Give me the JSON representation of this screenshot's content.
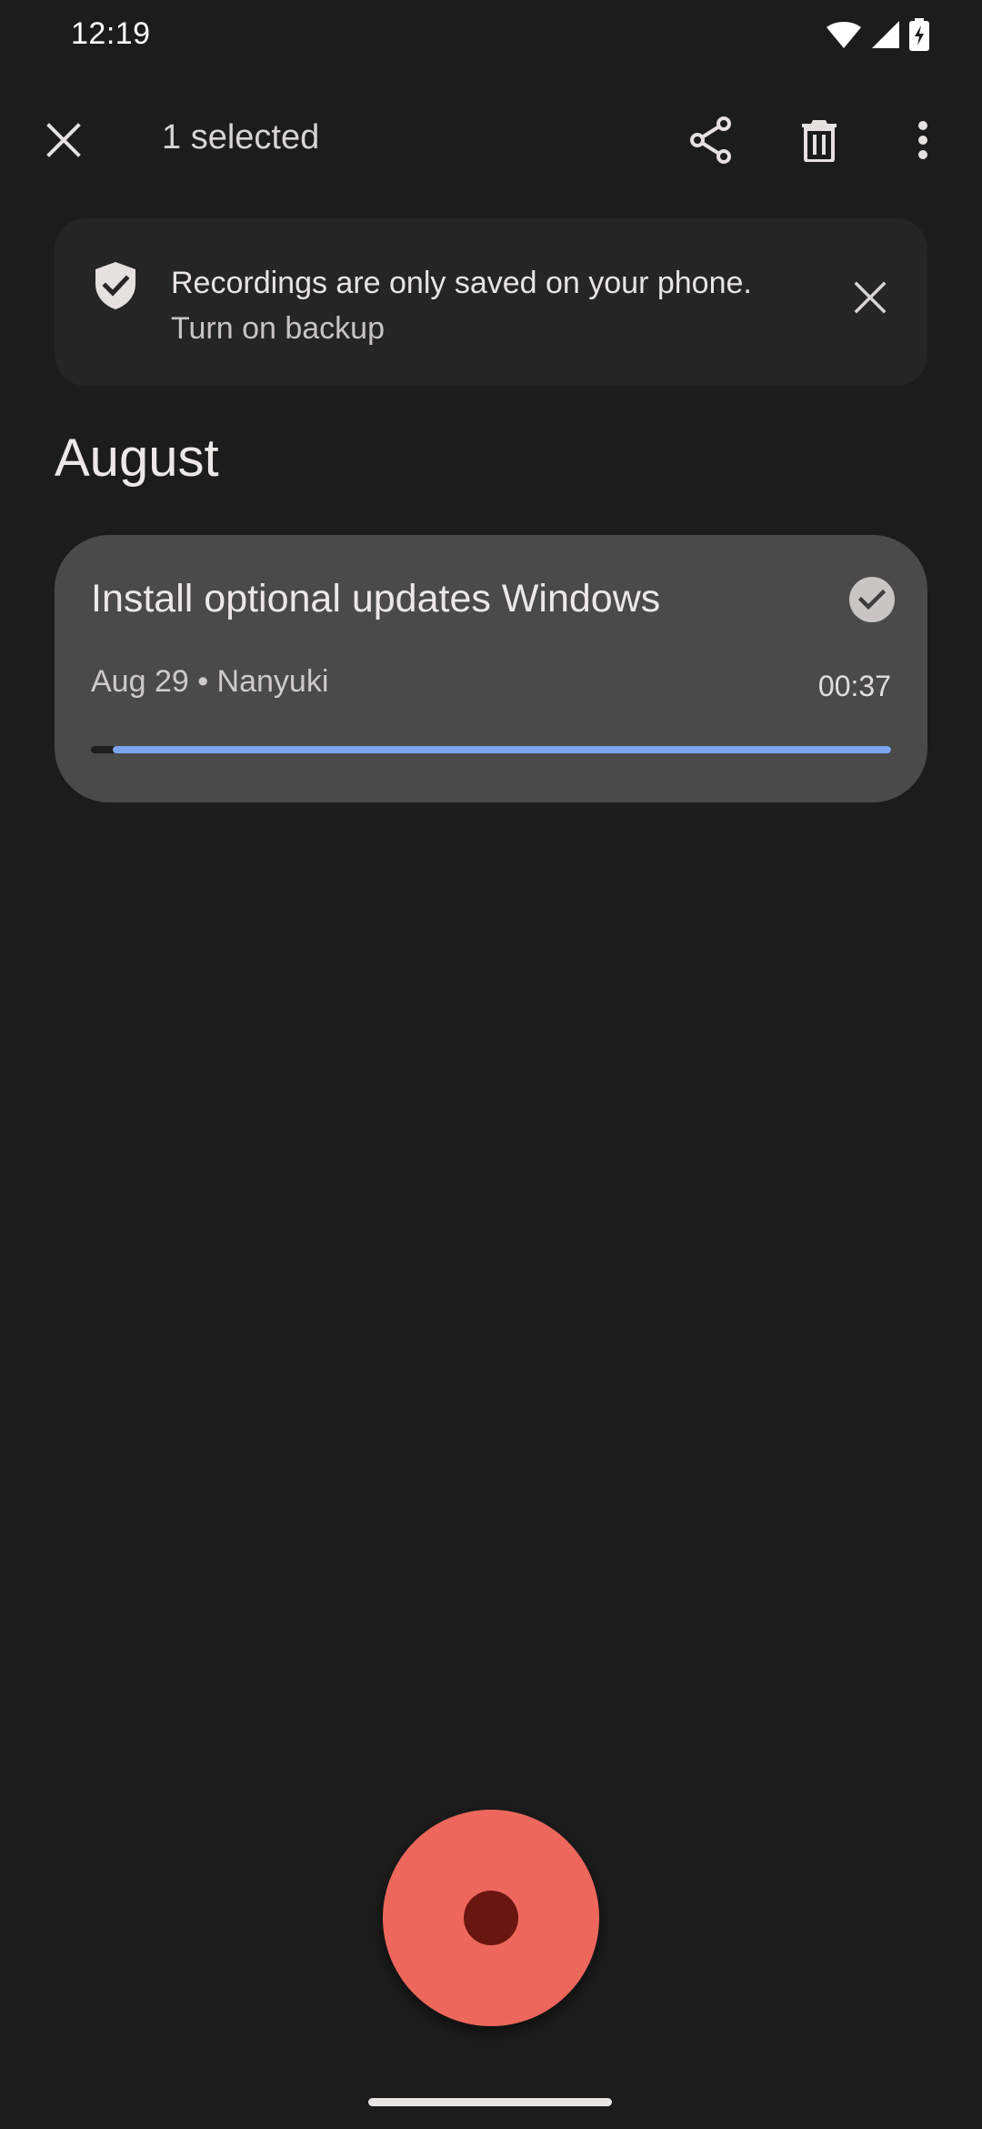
{
  "status_bar": {
    "time": "12:19",
    "icons": [
      "wifi-icon",
      "cell-signal-icon",
      "battery-charging-icon"
    ]
  },
  "app_bar": {
    "title": "1 selected",
    "icons": [
      "close-icon",
      "share-icon",
      "delete-icon",
      "more-vert-icon"
    ]
  },
  "banner": {
    "message": "Recordings are only saved on your phone.",
    "action": "Turn on backup",
    "icons": [
      "shield-check-icon",
      "close-icon"
    ]
  },
  "section": {
    "title": "August"
  },
  "recordings": [
    {
      "title": "Install optional updates Windows",
      "meta": "Aug 29 • Nanyuki",
      "duration": "00:37",
      "selected": true,
      "progress_fraction": 0.973
    }
  ],
  "fab": {
    "icon": "record-icon",
    "color": "#ed675c"
  },
  "colors": {
    "background": "#1c1c1c",
    "card": "#4a4a4a",
    "banner": "#252525",
    "progress": "#7ea6f0",
    "record": "#ed675c"
  }
}
